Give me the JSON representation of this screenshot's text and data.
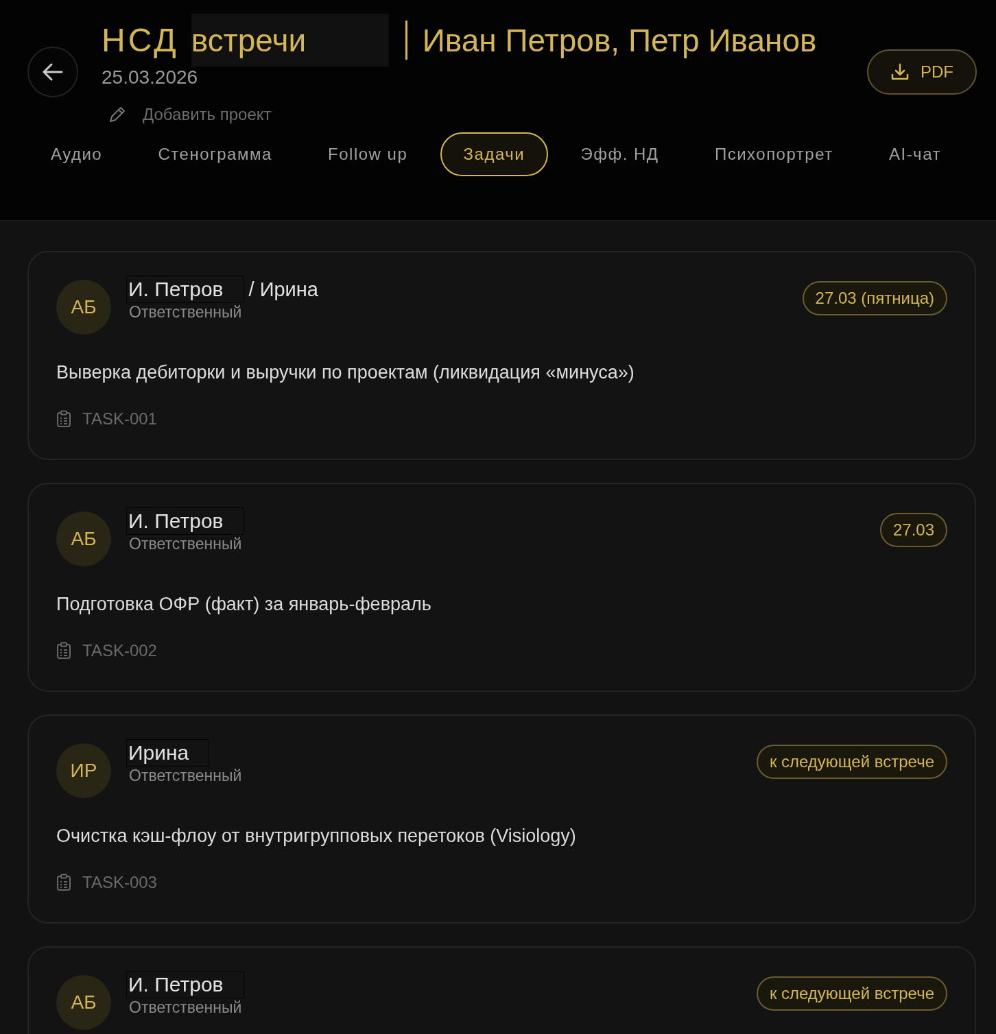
{
  "header": {
    "brand": "НСД",
    "title": "встречи",
    "participants": "Иван Петров, Петр Иванов",
    "date": "25.03.2026",
    "add_project": "Добавить проект",
    "pdf_button": "PDF"
  },
  "tabs": [
    {
      "label": "Аудио",
      "selected": false
    },
    {
      "label": "Стенограмма",
      "selected": false
    },
    {
      "label": "Follow up",
      "selected": false
    },
    {
      "label": "Задачи",
      "selected": true
    },
    {
      "label": "Эфф. НД",
      "selected": false
    },
    {
      "label": "Психопортрет",
      "selected": false
    },
    {
      "label": "AI-чат",
      "selected": false
    }
  ],
  "tasks": [
    {
      "initials": "АБ",
      "assignee": "И. Петров",
      "co_assignee": "/ Ирина",
      "role": "Ответственный",
      "due": "27.03 (пятница)",
      "description": "Выверка дебиторки и выручки по проектам (ликвидация «минуса»)",
      "task_id": "TASK-001"
    },
    {
      "initials": "АБ",
      "assignee": "И. Петров",
      "role": "Ответственный",
      "due": "27.03",
      "description": "Подготовка ОФР (факт) за январь-февраль",
      "task_id": "TASK-002"
    },
    {
      "initials": "ИР",
      "assignee": "Ирина",
      "role": "Ответственный",
      "due": "к следующей встрече",
      "description": "Очистка кэш-флоу от внутригрупповых перетоков (Visiology)",
      "task_id": "TASK-003"
    },
    {
      "initials": "АБ",
      "assignee": "И. Петров",
      "role": "Ответственный",
      "due": "к следующей встрече"
    }
  ]
}
